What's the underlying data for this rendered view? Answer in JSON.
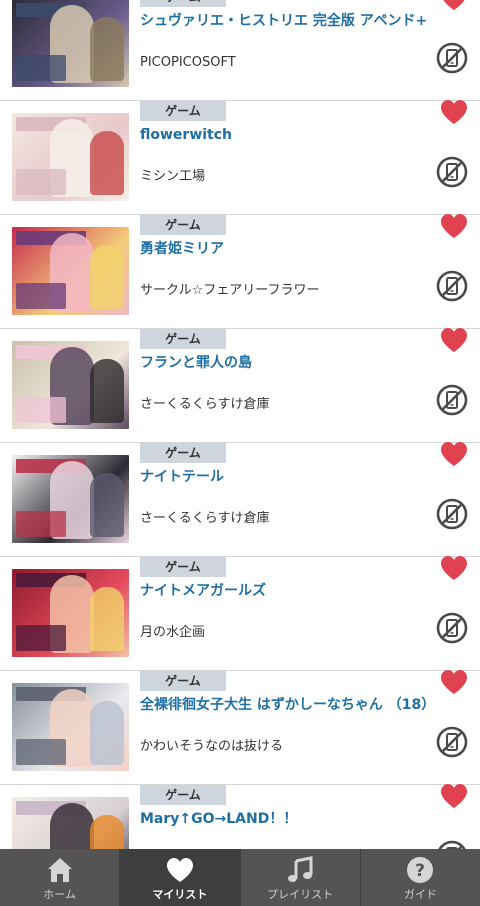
{
  "colors": {
    "accent_title": "#1f6fa3",
    "heart": "#e0424f",
    "category_bg": "#cfd5dc",
    "tabbar_bg": "#545454",
    "tabbar_active_bg": "#3e3e3e"
  },
  "items": [
    {
      "category": "ゲーム",
      "title": "シュヴァリエ・ヒストリエ 完全版 アペンド+",
      "circle": "PICOPICOSOFT",
      "favorite": true,
      "thumb_colors": [
        "#2b2a35",
        "#6a5c8c",
        "#d7c8b0",
        "#3c4a6a",
        "#8b7a5a"
      ]
    },
    {
      "category": "ゲーム",
      "title": "flowerwitch",
      "circle": "ミシン工場",
      "favorite": true,
      "thumb_colors": [
        "#f2e7e4",
        "#e7c9c9",
        "#f7f0ea",
        "#d9b8c0",
        "#c94a4a"
      ]
    },
    {
      "category": "ゲーム",
      "title": "勇者姫ミリア",
      "circle": "サークル☆フェアリーフラワー",
      "favorite": true,
      "thumb_colors": [
        "#c7294e",
        "#f4c97a",
        "#f2b7c6",
        "#6a3b78",
        "#f1d36a"
      ]
    },
    {
      "category": "ゲーム",
      "title": "フランと罪人の島",
      "circle": "さーくるくらすけ倉庫",
      "favorite": true,
      "thumb_colors": [
        "#c9c1a8",
        "#efe6dc",
        "#5a4a5f",
        "#f1c4d6",
        "#2e2a2c"
      ]
    },
    {
      "category": "ゲーム",
      "title": "ナイトテール",
      "circle": "さーくるくらすけ倉庫",
      "favorite": true,
      "thumb_colors": [
        "#f3f1f1",
        "#2d2a33",
        "#e9d4de",
        "#b8334a",
        "#5b5a6e"
      ]
    },
    {
      "category": "ゲーム",
      "title": "ナイトメアガールズ",
      "circle": "月の水企画",
      "favorite": true,
      "thumb_colors": [
        "#8f1a2c",
        "#e44b5c",
        "#f3c1a7",
        "#4c1a3a",
        "#f0d26a"
      ]
    },
    {
      "category": "ゲーム",
      "title": "全裸徘徊女子大生 はずかしーなちゃん （18）",
      "circle": "かわいそうなのは抜ける",
      "favorite": true,
      "thumb_colors": [
        "#8a8f99",
        "#e9e9ee",
        "#f2d2c6",
        "#5b6170",
        "#b9c2cf"
      ]
    },
    {
      "category": "ゲーム",
      "title": "Mary↑GO→LAND！！",
      "circle": "",
      "favorite": true,
      "thumb_colors": [
        "#f4ede6",
        "#d7cfd3",
        "#3a3038",
        "#c9b6c8",
        "#e98a2b"
      ]
    }
  ],
  "tabbar": {
    "tabs": [
      {
        "label": "ホーム",
        "icon": "home-icon",
        "active": false
      },
      {
        "label": "マイリスト",
        "icon": "heart-icon",
        "active": true
      },
      {
        "label": "プレイリスト",
        "icon": "music-note-icon",
        "active": false
      },
      {
        "label": "ガイド",
        "icon": "help-icon",
        "active": false
      }
    ]
  }
}
